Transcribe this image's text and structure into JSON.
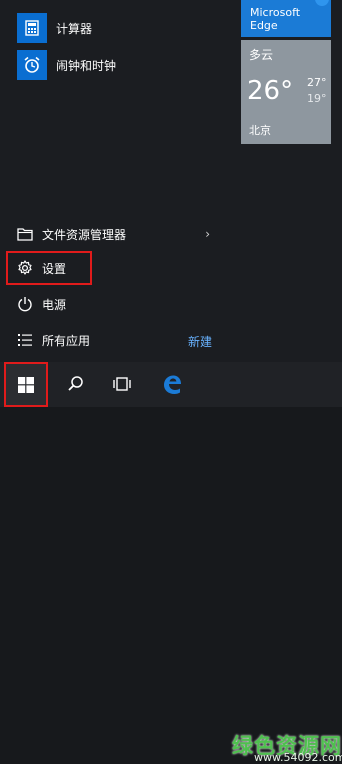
{
  "start_menu": {
    "apps": [
      {
        "label": "计算器",
        "icon": "calculator-icon"
      },
      {
        "label": "闹钟和时钟",
        "icon": "alarm-clock-icon"
      }
    ],
    "file_explorer_label": "文件资源管理器",
    "settings_label": "设置",
    "power_label": "电源",
    "all_apps_label": "所有应用",
    "new_label": "新建",
    "chevron": "›"
  },
  "tiles": {
    "edge_label": "Microsoft Edge",
    "weather": {
      "condition": "多云",
      "temperature": "26°",
      "high": "27°",
      "low": "19°",
      "city": "北京"
    }
  },
  "taskbar": {
    "items": [
      "windows-start-icon",
      "search-icon",
      "task-view-icon",
      "edge-browser-icon"
    ]
  },
  "watermark": {
    "text": "绿色资源网",
    "url": "www.54092.com"
  },
  "colors": {
    "accent": "#0a6ed1",
    "highlight": "#e01b1b",
    "link": "#68b2ff",
    "weather_tile": "#8e979f"
  }
}
